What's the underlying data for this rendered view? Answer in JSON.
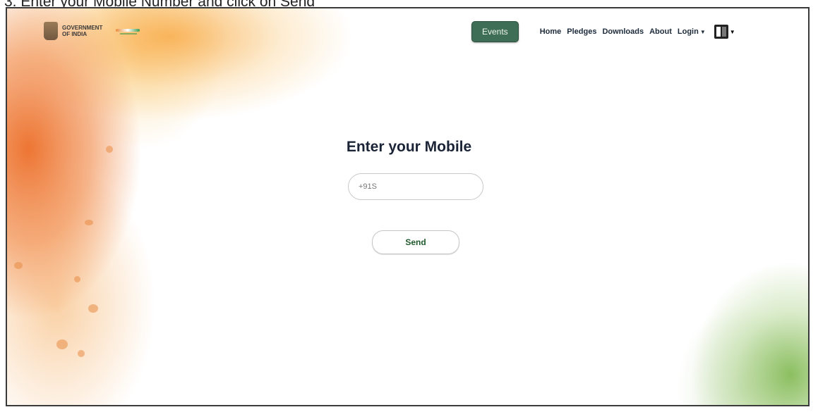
{
  "caption": "3. Enter your Mobile Number and click on Send",
  "header": {
    "logo_text": "GOVERNMENT OF INDIA",
    "nav": {
      "events": "Events",
      "home": "Home",
      "pledges": "Pledges",
      "downloads": "Downloads",
      "about": "About",
      "login": "Login"
    },
    "language_icon": "language-icon"
  },
  "main": {
    "heading": "Enter your Mobile",
    "mobile_input": {
      "placeholder": "+91 ",
      "value": "+91S"
    },
    "send_label": "Send"
  },
  "colors": {
    "events_button": "#3f6e56",
    "saffron": "#e86e28",
    "green": "#78b446",
    "send_text": "#1f5a2c"
  }
}
